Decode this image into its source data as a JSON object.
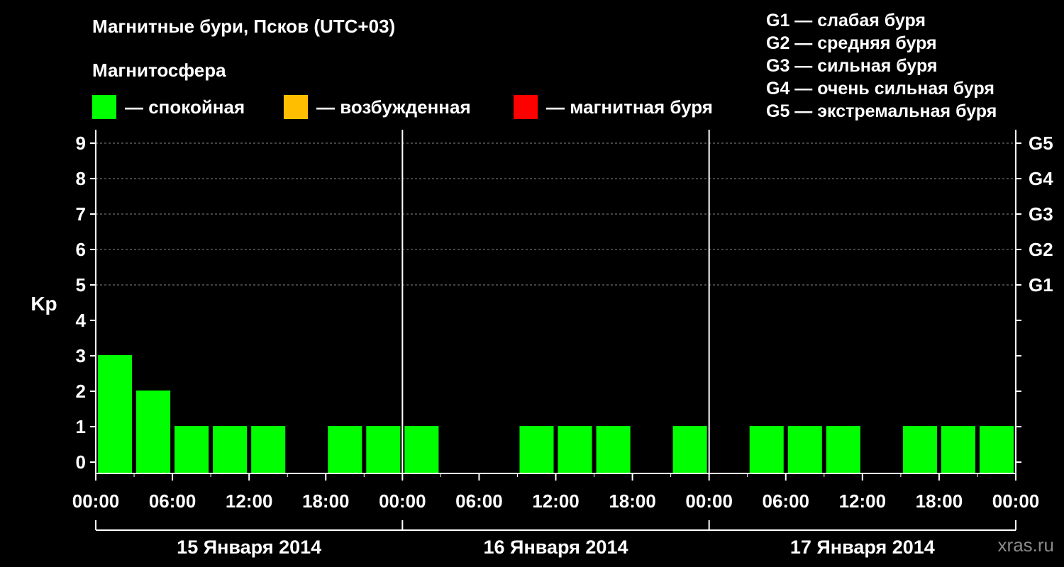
{
  "header": {
    "title": "Магнитные бури, Псков (UTC+03)",
    "subtitle": "Магнитосфера"
  },
  "legend": [
    {
      "label": "— спокойная",
      "color": "#00ff00"
    },
    {
      "label": "— возбужденная",
      "color": "#ffbf00"
    },
    {
      "label": "— магнитная буря",
      "color": "#ff0000"
    }
  ],
  "g_levels": [
    "G1 — слабая буря",
    "G2 — средняя буря",
    "G3 — сильная буря",
    "G4 — очень сильная буря",
    "G5 — экстремальная буря"
  ],
  "watermark": "xras.ru",
  "chart_data": {
    "type": "bar",
    "ylabel": "Kp",
    "ylim": [
      0,
      9
    ],
    "yticks": [
      "0",
      "1",
      "2",
      "3",
      "4",
      "5",
      "6",
      "7",
      "8",
      "9"
    ],
    "right_ticks": [
      {
        "kp": 5,
        "label": "G1"
      },
      {
        "kp": 6,
        "label": "G2"
      },
      {
        "kp": 7,
        "label": "G3"
      },
      {
        "kp": 8,
        "label": "G4"
      },
      {
        "kp": 9,
        "label": "G5"
      }
    ],
    "grid": "dashed horizontal at Kp 5-9",
    "xtick_labels": [
      "00:00",
      "06:00",
      "12:00",
      "18:00",
      "00:00",
      "06:00",
      "12:00",
      "18:00",
      "00:00",
      "06:00",
      "12:00",
      "18:00",
      "00:00"
    ],
    "days": [
      "15 Января 2014",
      "16 Января 2014",
      "17 Января 2014"
    ],
    "interval_hours": 3,
    "values": [
      3,
      2,
      1,
      1,
      1,
      0,
      1,
      1,
      1,
      0,
      0,
      1,
      1,
      1,
      0,
      1,
      0,
      1,
      1,
      1,
      0,
      1,
      1,
      1
    ],
    "bar_color": "#00ff00"
  }
}
